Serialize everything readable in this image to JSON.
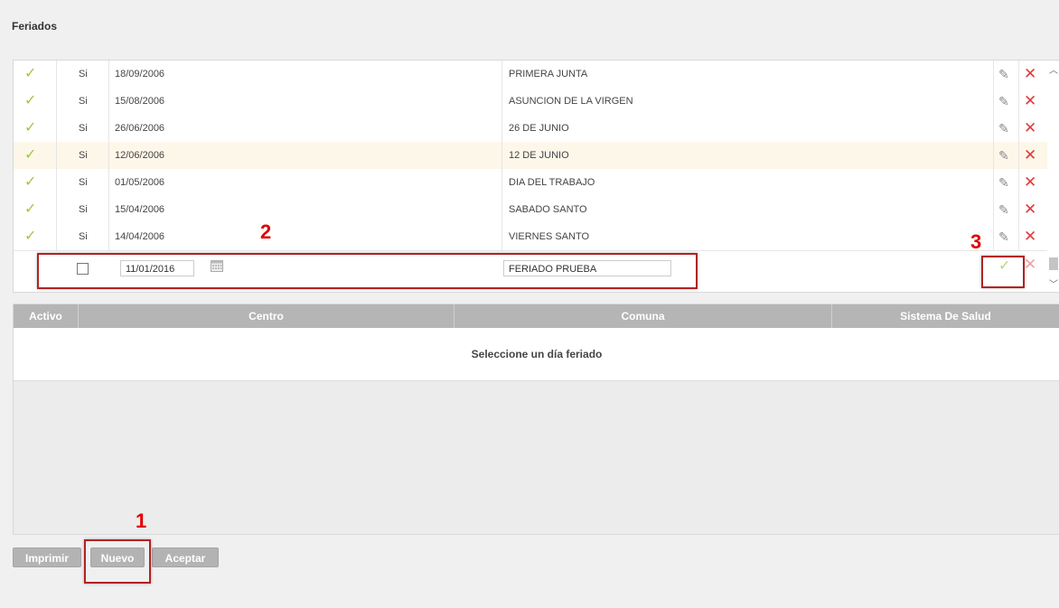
{
  "page": {
    "title": "Feriados"
  },
  "holidays": [
    {
      "active": "✓",
      "si": "Si",
      "date": "18/09/2006",
      "name": "PRIMERA JUNTA"
    },
    {
      "active": "✓",
      "si": "Si",
      "date": "15/08/2006",
      "name": "ASUNCION DE LA VIRGEN"
    },
    {
      "active": "✓",
      "si": "Si",
      "date": "26/06/2006",
      "name": "26 DE JUNIO"
    },
    {
      "active": "✓",
      "si": "Si",
      "date": "12/06/2006",
      "name": "12 DE JUNIO"
    },
    {
      "active": "✓",
      "si": "Si",
      "date": "01/05/2006",
      "name": "DIA DEL TRABAJO"
    },
    {
      "active": "✓",
      "si": "Si",
      "date": "15/04/2006",
      "name": "SABADO SANTO"
    },
    {
      "active": "✓",
      "si": "Si",
      "date": "14/04/2006",
      "name": "VIERNES SANTO"
    }
  ],
  "new_row": {
    "date_value": "11/01/2016",
    "name_value": "FERIADO PRUEBA"
  },
  "detail_table": {
    "headers": [
      "Activo",
      "Centro",
      "Comuna",
      "Sistema De Salud"
    ],
    "empty_message": "Seleccione un día feriado"
  },
  "buttons": {
    "print": "Imprimir",
    "new": "Nuevo",
    "accept": "Aceptar"
  },
  "annotations": [
    "1",
    "2",
    "3"
  ],
  "icons": {
    "active_check": "check-icon",
    "edit": "pencil-icon",
    "delete": "close-icon",
    "calendar": "calendar-icon",
    "save": "check-icon",
    "cancel": "close-icon"
  },
  "colors": {
    "check_green": "#9fc83c",
    "delete_red": "#e03a3a",
    "annotation_red": "#e00000",
    "button_gray": "#b3b3b3",
    "header_gray": "#b5b5b5",
    "selected_row": "#fdf7ea"
  }
}
